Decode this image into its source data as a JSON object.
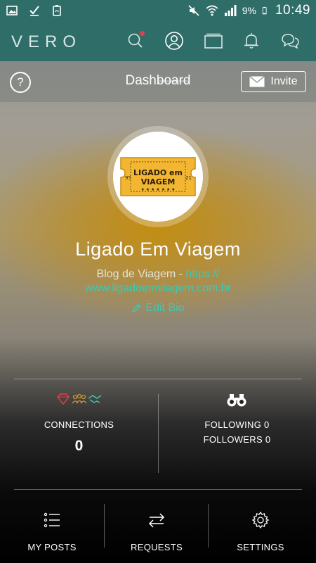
{
  "status_bar": {
    "battery": "9%",
    "time": "10:49",
    "icons": [
      "image-icon",
      "check-icon",
      "recycle-icon",
      "mute-icon",
      "wifi-icon",
      "signal-icon",
      "battery-icon"
    ]
  },
  "nav": {
    "logo": "VERO",
    "icons": [
      "search-icon",
      "profile-icon",
      "collections-icon",
      "bell-icon",
      "chat-icon"
    ],
    "accent": "#2f6d69",
    "notification_dot_color": "#e0424a"
  },
  "header": {
    "help": "?",
    "title": "Dashboard",
    "invite_label": "Invite"
  },
  "profile": {
    "avatar_text_line1": "LIGADO em",
    "avatar_text_line2": "VIAGEM",
    "avatar_num_left": "95",
    "avatar_num_right": "21",
    "name": "Ligado Em Viagem",
    "bio_prefix": "Blog de Viagem - ",
    "bio_link_part1": "https://",
    "bio_link_part2": "www.ligadoemviagem.com.br",
    "edit_bio": "Edit Bio",
    "link_color": "#3ec9b4"
  },
  "stats": {
    "connections_label": "CONNECTIONS",
    "connections_value": "0",
    "following": "FOLLOWING 0",
    "followers": "FOLLOWERS 0"
  },
  "menu": {
    "items": [
      {
        "label": "MY POSTS",
        "icon": "list-icon"
      },
      {
        "label": "REQUESTS",
        "icon": "transfer-arrows-icon"
      },
      {
        "label": "SETTINGS",
        "icon": "gear-icon"
      }
    ]
  }
}
